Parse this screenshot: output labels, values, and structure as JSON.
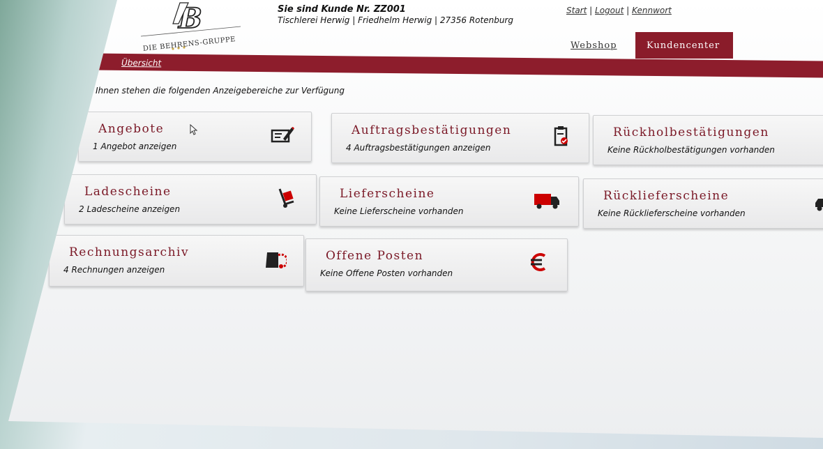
{
  "header": {
    "logo_text": "DIE BEHRENS-GRUPPE",
    "customer_line": "Sie sind Kunde Nr. ZZ001",
    "company_line": "Tischlerei Herwig | Friedhelm Herwig | 27356 Rotenburg",
    "links": {
      "start": "Start",
      "logout": "Logout",
      "password": "Kennwort",
      "separator": "|"
    },
    "tabs": {
      "webshop": "Webshop",
      "kundencenter": "Kundencenter"
    }
  },
  "nav": {
    "overview": "Übersicht"
  },
  "intro": "Ihnen stehen die folgenden Anzeigebereiche zur Verfügung",
  "tiles": [
    {
      "title": "Angebote",
      "sub": "1 Angebot anzeigen",
      "icon": "edit-document-icon"
    },
    {
      "title": "Auftragsbestätigungen",
      "sub": "4 Auftragsbestätigungen anzeigen",
      "icon": "clipboard-check-icon"
    },
    {
      "title": "Rückholbestätigungen",
      "sub": "Keine Rückholbestätigungen vorhanden",
      "icon": "return-icon"
    },
    {
      "title": "Ladescheine",
      "sub": "2 Ladescheine anzeigen",
      "icon": "hand-truck-icon"
    },
    {
      "title": "Lieferscheine",
      "sub": "Keine Lieferscheine vorhanden",
      "icon": "truck-icon"
    },
    {
      "title": "Rücklieferscheine",
      "sub": "Keine Rücklieferscheine vorhanden",
      "icon": "return-truck-icon"
    },
    {
      "title": "Rechnungsarchiv",
      "sub": "4 Rechnungen anzeigen",
      "icon": "invoice-archive-icon"
    },
    {
      "title": "Offene Posten",
      "sub": "Keine Offene Posten vorhanden",
      "icon": "euro-icon"
    }
  ],
  "colors": {
    "brand": "#8a1c2a",
    "tile_title": "#7a1826"
  }
}
